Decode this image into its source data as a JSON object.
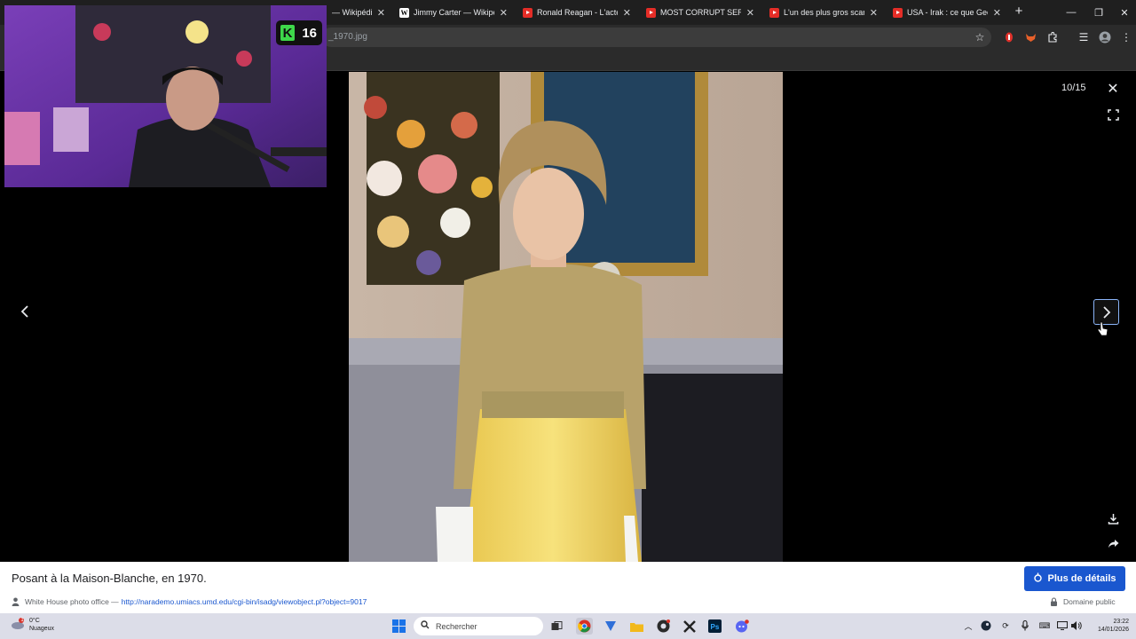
{
  "browser": {
    "tabs": [
      {
        "label": "— Wikipédia",
        "favicon": "wikipedia"
      },
      {
        "label": "Jimmy Carter — Wikipédia",
        "favicon": "wikipedia"
      },
      {
        "label": "Ronald Reagan - L'acteur",
        "favicon": "youtube"
      },
      {
        "label": "MOST CORRUPT SERIES",
        "favicon": "youtube"
      },
      {
        "label": "L'un des plus gros scandale",
        "favicon": "youtube"
      },
      {
        "label": "USA - Irak : ce que Georg",
        "favicon": "youtube"
      }
    ],
    "url": "_1970.jpg"
  },
  "viewer": {
    "counter": "10/15"
  },
  "caption": {
    "text": "Posant à la Maison-Blanche, en 1970.",
    "details_button": "Plus de détails",
    "source_prefix": "White House photo office —",
    "source_link": "http://narademo.umiacs.umd.edu/cgi-bin/isadg/viewobject.pl?object=9017",
    "license": "Domaine public"
  },
  "taskbar": {
    "weather_temp": "0°C",
    "weather_desc": "Nuageux",
    "weather_alert": "1",
    "search_placeholder": "Rechercher",
    "time": "23:22",
    "date": "14/01/2026"
  },
  "webcam": {
    "badge_number": "16"
  },
  "colors": {
    "accent": "#1a57cf",
    "focus_ring": "#8ab4f8",
    "tab_bar": "#1f1f1f",
    "taskbar": "#dcdde8"
  }
}
